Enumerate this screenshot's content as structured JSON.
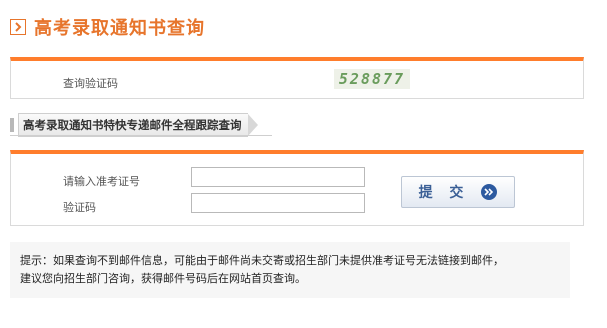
{
  "header": {
    "title": "高考录取通知书查询",
    "icon": "chevron-right-icon",
    "accent": "#e7752c"
  },
  "query": {
    "captcha_label": "查询验证码",
    "captcha_code": "528877"
  },
  "tracking": {
    "section_title": "高考录取通知书特快专递邮件全程跟踪查询"
  },
  "form": {
    "exam_number_label": "请输入准考证号",
    "exam_number_value": "",
    "captcha_label": "验证码",
    "captcha_value": "",
    "submit_label": "提 交",
    "submit_icon": "double-chevron-right-icon"
  },
  "tip": {
    "text": "提示：如果查询不到邮件信息，可能由于邮件尚未交寄或招生部门未提供准考证号无法链接到邮件，\n建议您向招生部门咨询，获得邮件号码后在网站首页查询。"
  },
  "colors": {
    "panel_top_border": "#ff7d2c",
    "submit_text": "#3a5f96",
    "submit_arrow_bg": "#2d5aa0"
  }
}
